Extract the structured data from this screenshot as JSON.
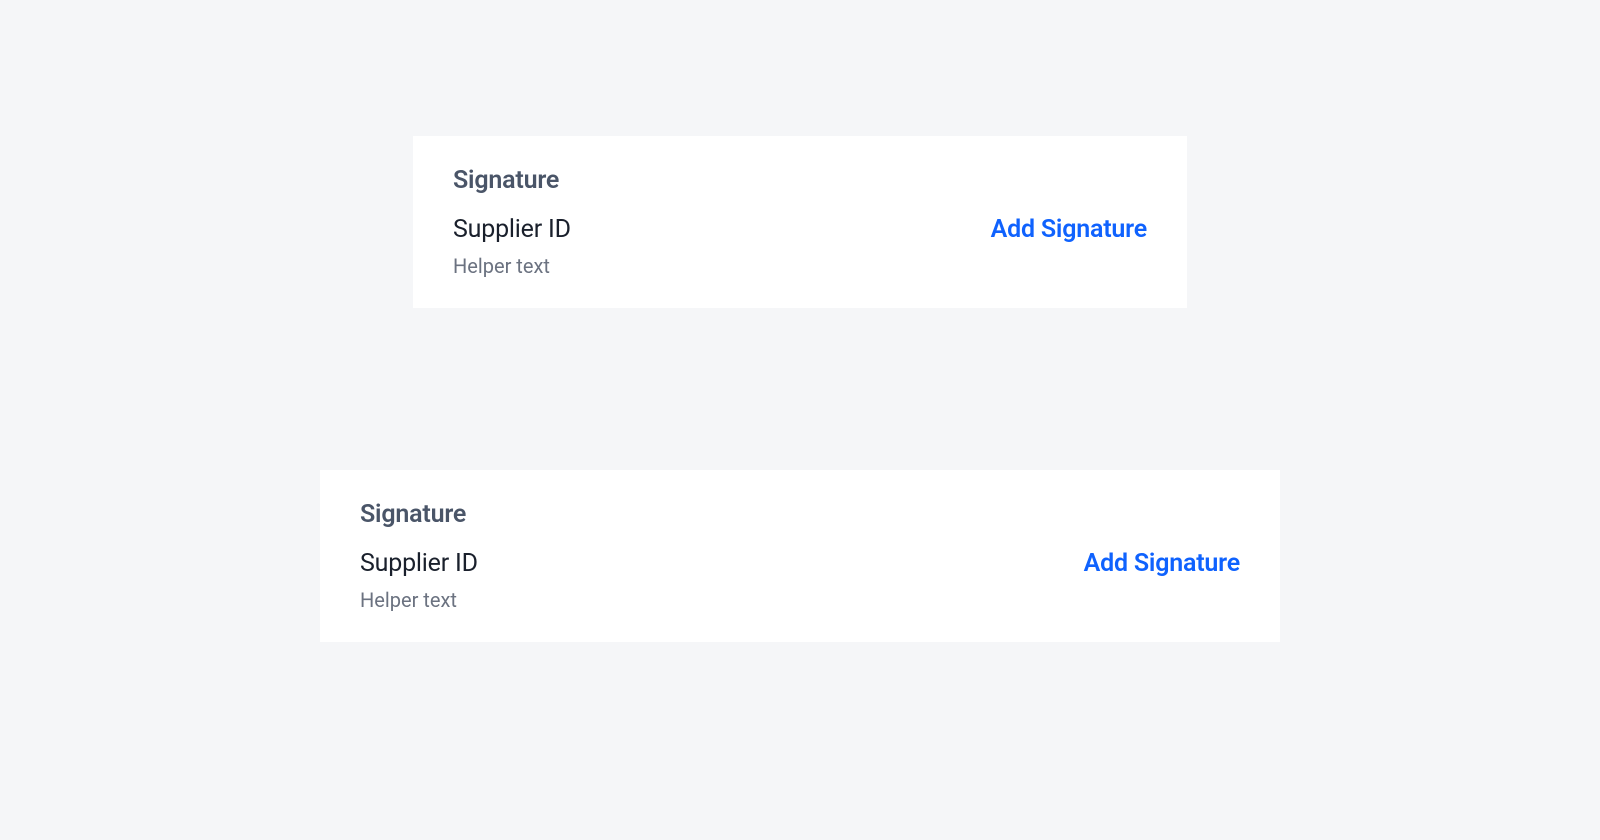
{
  "card1": {
    "title": "Signature",
    "field_label": "Supplier ID",
    "action_label": "Add Signature",
    "helper_text": "Helper text"
  },
  "card2": {
    "title": "Signature",
    "field_label": "Supplier ID",
    "action_label": "Add Signature",
    "helper_text": "Helper text"
  }
}
